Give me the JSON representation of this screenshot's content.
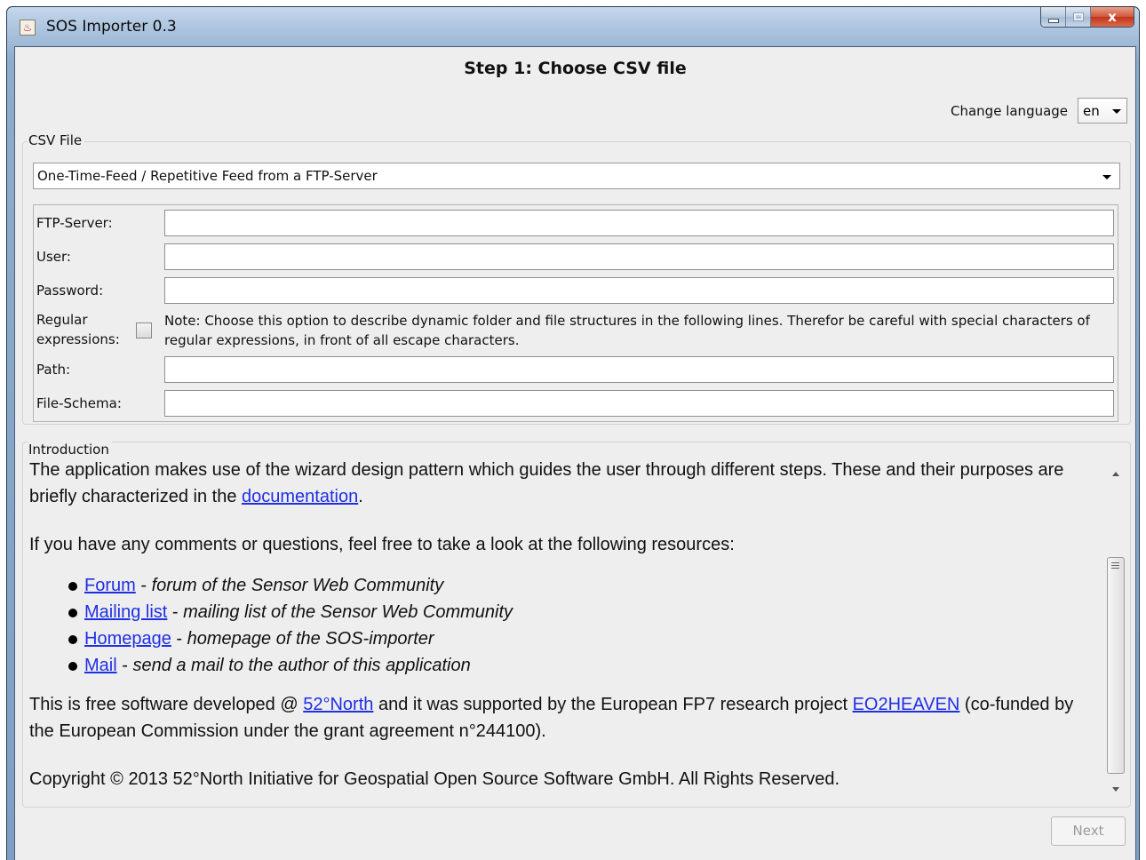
{
  "window": {
    "title": "SOS Importer 0.3",
    "close_glyph": "x"
  },
  "step_title": "Step 1: Choose CSV file",
  "language": {
    "label": "Change language",
    "selected": "en"
  },
  "csv_file": {
    "group_label": "CSV File",
    "feed_type": "One-Time-Feed / Repetitive Feed from a FTP-Server",
    "fields": {
      "ftp_server": {
        "label": "FTP-Server:",
        "value": ""
      },
      "user": {
        "label": "User:",
        "value": ""
      },
      "password": {
        "label": "Password:",
        "value": ""
      },
      "regex_line1": "Regular",
      "regex_line2": "expressions:",
      "regex_checked": false,
      "regex_note": "Note: Choose this option to describe dynamic folder and file structures in the following lines. Therefor be careful with special characters of regular expressions, in front of all escape characters.",
      "path": {
        "label": "Path:",
        "value": ""
      },
      "file_schema": {
        "label": "File-Schema:",
        "value": ""
      }
    }
  },
  "introduction": {
    "group_label": "Introduction",
    "p1_text": "The application makes use of the wizard design pattern which guides the user through different steps. These and their purposes are briefly characterized in the ",
    "p1_link": "documentation",
    "p1_end": ".",
    "p2": "If you have any comments or questions, feel free to take a look at the following resources:",
    "resources": [
      {
        "link": "Forum",
        "desc": "forum of the Sensor Web Community"
      },
      {
        "link": "Mailing list",
        "desc": "mailing list of the Sensor Web Community"
      },
      {
        "link": "Homepage",
        "desc": "homepage of the SOS-importer"
      },
      {
        "link": "Mail",
        "desc": "send a mail to the author of this application"
      }
    ],
    "dash": " - ",
    "p3_a": "This is free software developed @ ",
    "p3_link1": "52°North",
    "p3_b": " and it was supported by the European FP7 research project ",
    "p3_link2": "EO2HEAVEN",
    "p3_c": " (co-funded by the European Commission under the grant agreement n°244100).",
    "p4": "Copyright © 2013 52°North Initiative for Geospatial Open Source Software GmbH. All Rights Reserved."
  },
  "buttons": {
    "next": "Next"
  }
}
